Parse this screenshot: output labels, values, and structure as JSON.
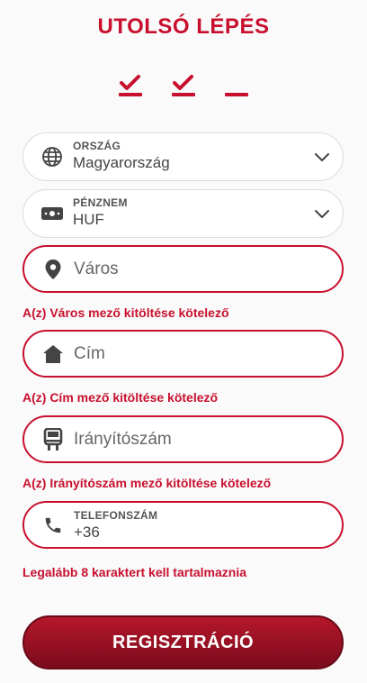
{
  "header": {
    "title": "UTOLSÓ LÉPÉS"
  },
  "steps": [
    {
      "state": "done"
    },
    {
      "state": "done"
    },
    {
      "state": "current"
    }
  ],
  "colors": {
    "accent": "#c8102e",
    "button_dark": "#7a0b1c"
  },
  "fields": {
    "country": {
      "label": "ORSZÁG",
      "value": "Magyarország",
      "icon": "globe-icon"
    },
    "currency": {
      "label": "PÉNZNEM",
      "value": "HUF",
      "icon": "banknote-icon"
    },
    "city": {
      "placeholder": "Város",
      "icon": "location-pin-icon",
      "error": "A(z) Város mező kitöltése kötelező"
    },
    "address": {
      "placeholder": "Cím",
      "icon": "home-icon",
      "error": "A(z) Cím mező kitöltése kötelező"
    },
    "zip": {
      "placeholder": "Irányítószám",
      "icon": "mailbox-icon",
      "error": "A(z) Irányítószám mező kitöltése kötelező"
    },
    "phone": {
      "label": "TELEFONSZÁM",
      "value": "+36",
      "icon": "phone-icon",
      "error": "Legalább 8 karaktert kell tartalmaznia"
    }
  },
  "submit": {
    "label": "REGISZTRÁCIÓ"
  }
}
